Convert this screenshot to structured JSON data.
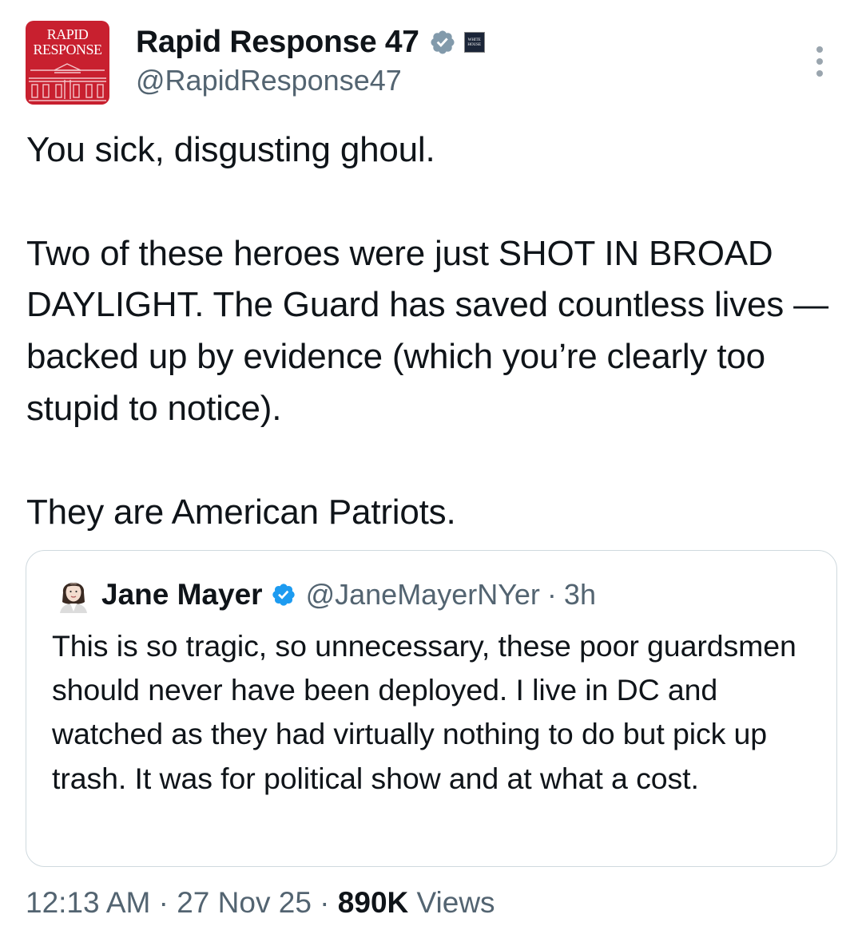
{
  "author": {
    "display_name": "Rapid Response 47",
    "handle": "@RapidResponse47",
    "avatar_lines": [
      "RAPID",
      "RESPONSE"
    ],
    "affiliation_badge": "WHITE HOUSE",
    "verified_icon": "verified-badge-gray"
  },
  "tweet": {
    "text": "You sick, disgusting ghoul.\n\nTwo of these heroes were just SHOT IN BROAD DAYLIGHT. The Guard has saved countless lives — backed up by evidence (which you’re clearly too stupid to notice).\n\nThey are American Patriots."
  },
  "quote": {
    "display_name": "Jane Mayer",
    "handle": "@JaneMayerNYer",
    "separator": "·",
    "time": "3h",
    "verified_icon": "verified-badge-blue",
    "text": "This is so tragic, so unnecessary, these poor guardsmen should never have been deployed. I live in DC and watched as they had virtually nothing to do but pick up trash. It was for political show and at what a cost."
  },
  "meta": {
    "time": "12:13 AM",
    "sep1": " · ",
    "date": "27 Nov 25",
    "sep2": " · ",
    "views_count": "890K",
    "views_label": " Views"
  },
  "colors": {
    "text": "#0f1419",
    "secondary": "#536471",
    "border": "#cfd9de",
    "verified_blue": "#1d9bf0",
    "verified_gray": "#829aab",
    "avatar_red": "#c8202f"
  }
}
